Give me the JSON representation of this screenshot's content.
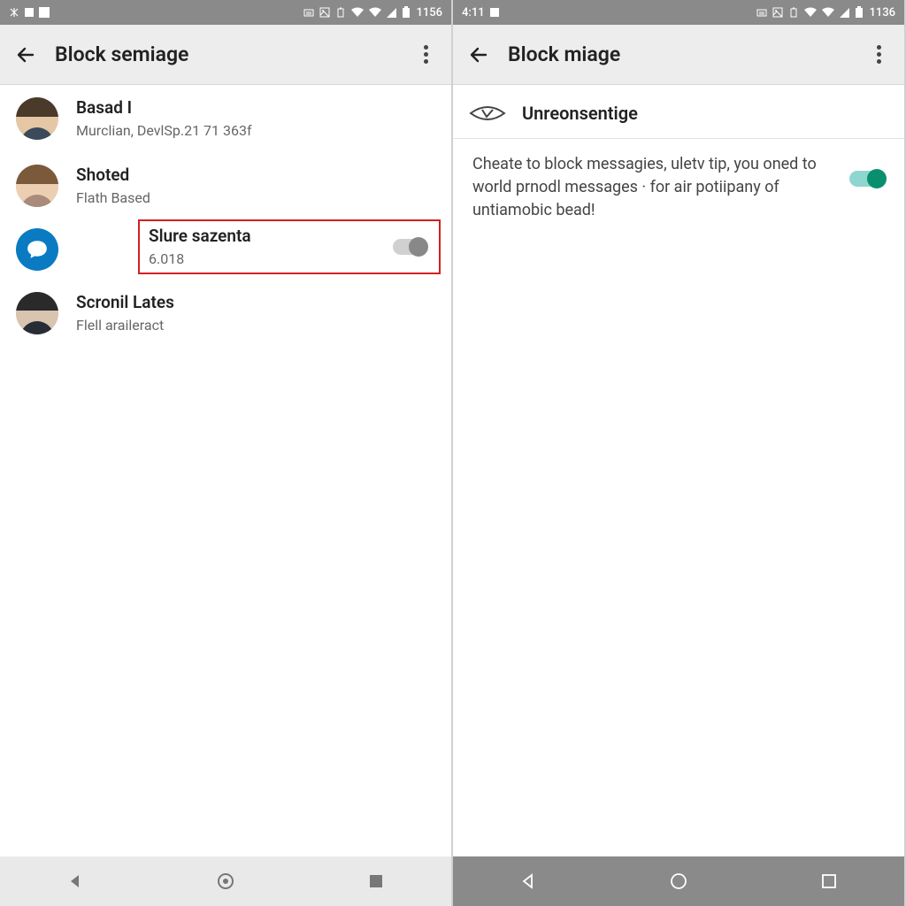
{
  "left": {
    "status": {
      "time": "1156"
    },
    "app_bar": {
      "title": "Block semiage"
    },
    "list": [
      {
        "title": "Basad I",
        "sub": "Murclian, DevlSp.21 71 363f"
      },
      {
        "title": "Shoted",
        "sub": "Flath Based"
      },
      {
        "title": "Slure sazenta",
        "sub": "6.018",
        "highlighted": true,
        "toggle": "off"
      },
      {
        "title": "Scronil Lates",
        "sub": "Flell araileract"
      }
    ]
  },
  "right": {
    "status": {
      "time_left": "4:11",
      "time_right": "1136"
    },
    "app_bar": {
      "title": "Block miage"
    },
    "setting": {
      "title": "Unreonsentige",
      "description": "Cheate to block messagies, uletv tip, you oned to world prnodl messages · for air potiipany of untiamobic bead!",
      "toggle": "on"
    }
  }
}
